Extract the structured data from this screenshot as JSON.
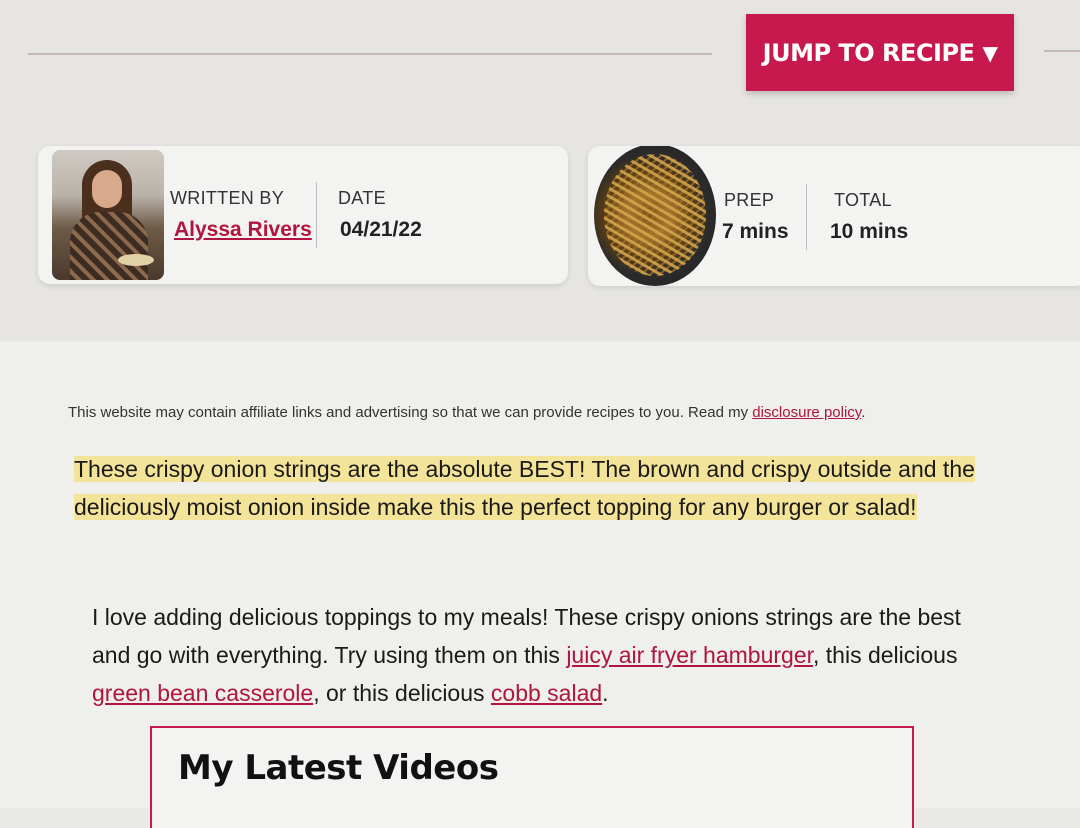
{
  "header": {
    "jump_label": "JUMP TO RECIPE",
    "jump_icon": "▼"
  },
  "author_card": {
    "written_by_label": "WRITTEN BY",
    "author_name": "Alyssa Rivers",
    "date_label": "DATE",
    "date_value": "04/21/22"
  },
  "recipe_card": {
    "prep_label": "PREP",
    "prep_value": "7 mins",
    "total_label": "TOTAL",
    "total_value": "10 mins"
  },
  "content": {
    "disclaimer_text": "This website may contain affiliate links and advertising so that we can provide recipes to you. Read my ",
    "disclaimer_link": "disclosure policy",
    "disclaimer_end": ".",
    "intro": "These crispy onion strings are the absolute BEST! The brown and crispy outside and the deliciously moist onion inside make this the perfect topping for any burger or salad!",
    "p2_a": "I love adding delicious toppings to my meals! These crispy onions strings are the best and go with everything. Try using them on this ",
    "p2_link1": "juicy air fryer hamburger",
    "p2_b": ", this delicious ",
    "p2_link2": "green bean casserole",
    "p2_c": ", or this delicious ",
    "p2_link3": "cobb salad",
    "p2_d": ".",
    "videos_title": "My Latest Videos"
  },
  "colors": {
    "brand": "#c8194f",
    "highlight": "#f4e49a",
    "link": "#b0143f"
  }
}
